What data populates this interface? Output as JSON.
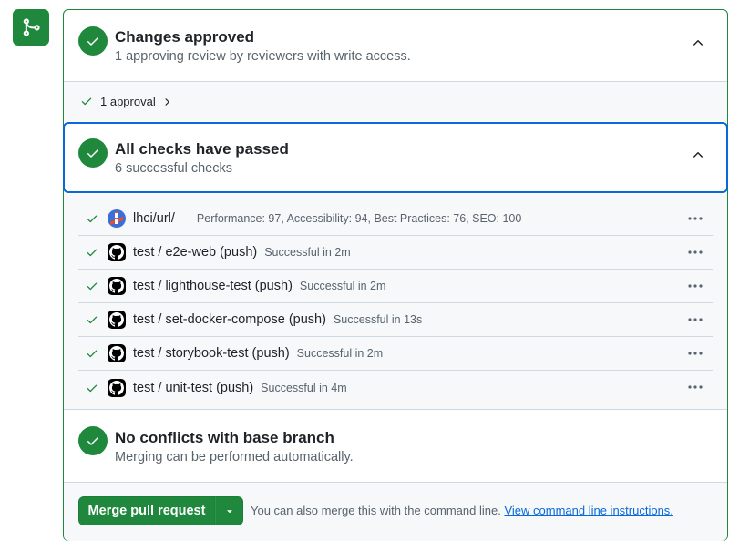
{
  "colors": {
    "success": "#1f883d",
    "accent": "#0969da",
    "muted": "#59636e"
  },
  "merge_icon": "git-merge-icon",
  "approval_section": {
    "title": "Changes approved",
    "subtitle": "1 approving review by reviewers with write access.",
    "approvals_link": "1 approval"
  },
  "checks_section": {
    "title": "All checks have passed",
    "subtitle": "6 successful checks",
    "items": [
      {
        "icon": "lighthouse-icon",
        "name": "lhci/url/",
        "status": "— Performance: 97, Accessibility: 94, Best Practices: 76, SEO: 100"
      },
      {
        "icon": "github-icon",
        "name": "test / e2e-web (push)",
        "status": "Successful in 2m"
      },
      {
        "icon": "github-icon",
        "name": "test / lighthouse-test (push)",
        "status": "Successful in 2m"
      },
      {
        "icon": "github-icon",
        "name": "test / set-docker-compose (push)",
        "status": "Successful in 13s"
      },
      {
        "icon": "github-icon",
        "name": "test / storybook-test (push)",
        "status": "Successful in 2m"
      },
      {
        "icon": "github-icon",
        "name": "test / unit-test (push)",
        "status": "Successful in 4m"
      }
    ]
  },
  "conflicts_section": {
    "title": "No conflicts with base branch",
    "subtitle": "Merging can be performed automatically."
  },
  "merge": {
    "button_label": "Merge pull request",
    "hint": "You can also merge this with the command line.",
    "hint_link": "View command line instructions."
  }
}
